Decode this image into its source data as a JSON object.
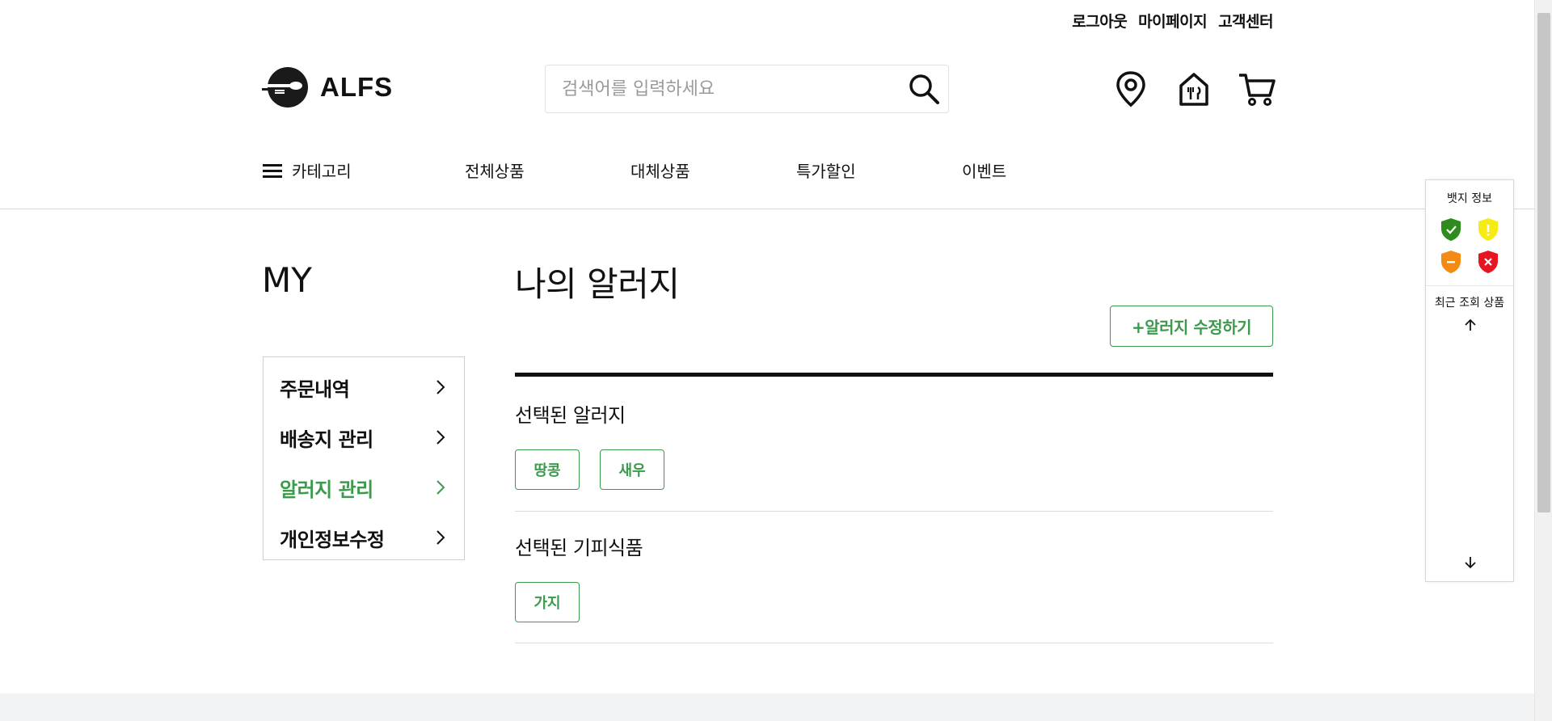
{
  "util_links": [
    "로그아웃",
    "마이페이지",
    "고객센터"
  ],
  "brand": {
    "name": "ALFS"
  },
  "search": {
    "placeholder": "검색어를 입력하세요"
  },
  "header_icons": [
    "location-pin-icon",
    "store-icon",
    "cart-icon"
  ],
  "nav": {
    "category_label": "카테고리",
    "items": [
      "전체상품",
      "대체상품",
      "특가할인",
      "이벤트"
    ]
  },
  "sidebar": {
    "title": "MY",
    "items": [
      {
        "label": "주문내역",
        "active": false
      },
      {
        "label": "배송지 관리",
        "active": false
      },
      {
        "label": "알러지 관리",
        "active": true
      },
      {
        "label": "개인정보수정",
        "active": false
      }
    ]
  },
  "main": {
    "title": "나의 알러지",
    "edit_button": "+알러지 수정하기",
    "selected_allergy_title": "선택된 알러지",
    "allergy_tags": [
      "땅콩",
      "새우"
    ],
    "selected_avoid_title": "선택된 기피식품",
    "avoid_tags": [
      "가지"
    ]
  },
  "float_panel": {
    "badge_title": "뱃지 정보",
    "badges": [
      {
        "name": "safe-badge-icon",
        "color": "#2e8b1e",
        "symbol": "✓"
      },
      {
        "name": "caution-badge-icon",
        "color": "#f5ec16",
        "symbol": "!"
      },
      {
        "name": "warning-badge-icon",
        "color": "#f28a14",
        "symbol": "−"
      },
      {
        "name": "danger-badge-icon",
        "color": "#e8141f",
        "symbol": "✕"
      }
    ],
    "recent_title": "최근 조회 상품"
  },
  "colors": {
    "accent": "#3b9a4c",
    "text": "#111111"
  }
}
